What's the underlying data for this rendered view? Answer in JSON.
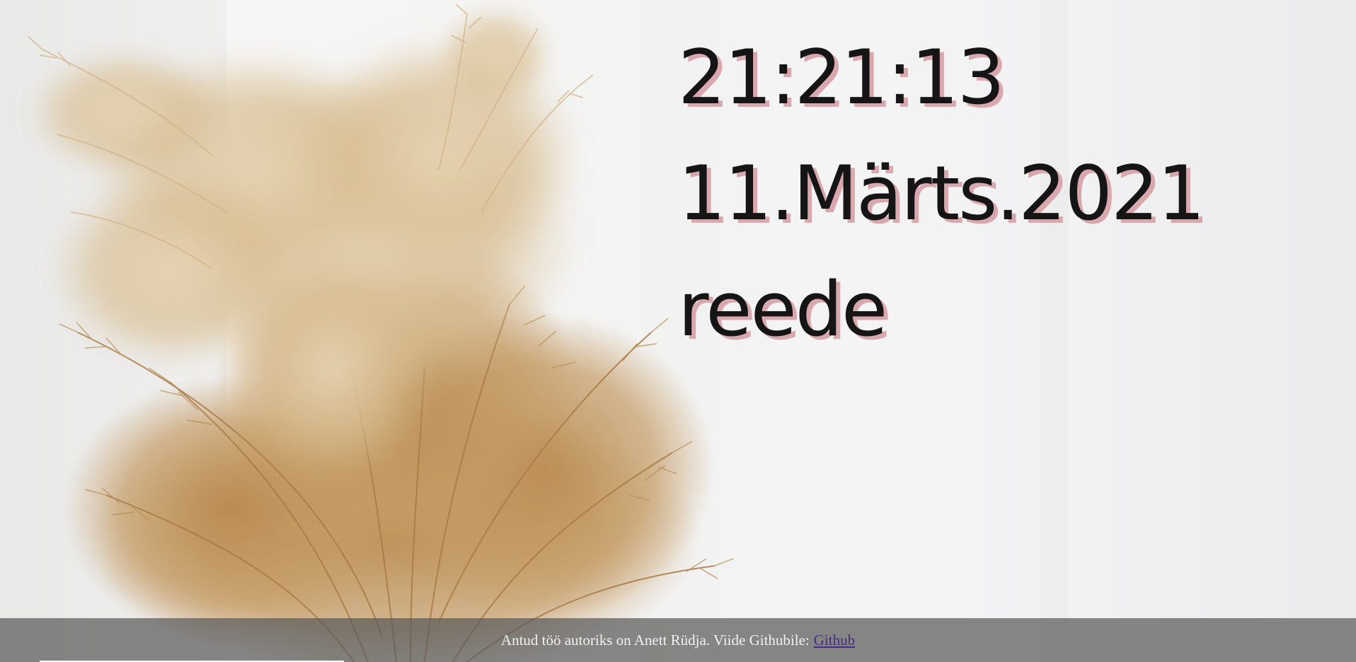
{
  "clock": {
    "time": "21:21:13",
    "date": "11.Märts.2021",
    "weekday": "reede"
  },
  "footer": {
    "text": "Antud töö autoriks on Anett Rüdja. Viide Githubile:",
    "link_label": "Github"
  },
  "colors": {
    "text": "#151515",
    "text_shadow": "#d9a8ae",
    "footer_bg": "#5a5a5a",
    "link": "#4b2a86"
  },
  "icons": {
    "background": "dried-pampas-grass-image"
  }
}
